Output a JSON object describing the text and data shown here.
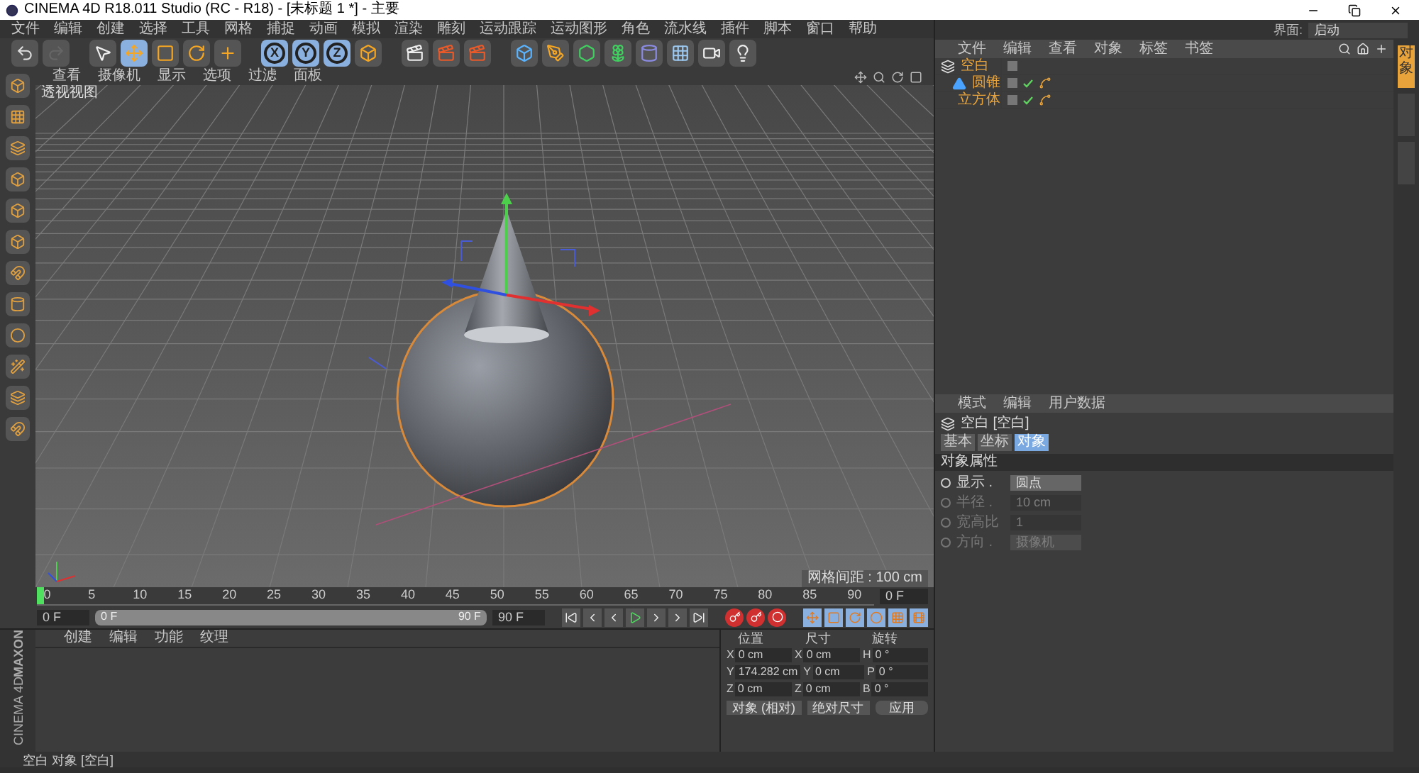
{
  "window": {
    "title": "CINEMA 4D R18.011 Studio (RC - R18) - [未标题 1 *] - 主要"
  },
  "menu_bar": [
    "文件",
    "编辑",
    "创建",
    "选择",
    "工具",
    "网格",
    "捕捉",
    "动画",
    "模拟",
    "渲染",
    "雕刻",
    "运动跟踪",
    "运动图形",
    "角色",
    "流水线",
    "插件",
    "脚本",
    "窗口",
    "帮助"
  ],
  "layout_selector": {
    "label": "界面:",
    "value": "启动"
  },
  "toolbar": {
    "tools": [
      {
        "kind": "select",
        "selected": false
      },
      {
        "kind": "move",
        "selected": true
      },
      {
        "kind": "scale",
        "selected": false
      },
      {
        "kind": "rotate",
        "selected": false
      },
      {
        "kind": "add",
        "selected": false
      }
    ],
    "axes": [
      {
        "label": "X",
        "selected": true
      },
      {
        "label": "Y",
        "selected": true
      },
      {
        "label": "Z",
        "selected": true
      }
    ]
  },
  "viewport": {
    "menus": [
      "查看",
      "摄像机",
      "显示",
      "选项",
      "过滤",
      "面板"
    ],
    "label": "透视视图",
    "grid_info": "网格间距 : 100 cm"
  },
  "object_manager": {
    "menus": [
      "文件",
      "编辑",
      "查看",
      "对象",
      "标签",
      "书签"
    ],
    "side_tabs": [
      {
        "label": "对象",
        "selected": true
      },
      {
        "selected": false
      },
      {
        "selected": false
      }
    ],
    "objects": [
      {
        "name": "空白",
        "kind": "null",
        "children": [
          {
            "name": "圆锥",
            "kind": "cone"
          },
          {
            "name": "立方体",
            "kind": "cube"
          }
        ]
      }
    ]
  },
  "attributes": {
    "menus": [
      "模式",
      "编辑",
      "用户数据"
    ],
    "title": "空白 [空白]",
    "tabs": [
      {
        "label": "基本",
        "selected": false
      },
      {
        "label": "坐标",
        "selected": false
      },
      {
        "label": "对象",
        "selected": true
      }
    ],
    "section": "对象属性",
    "fields": [
      {
        "label": "显示 .",
        "value": "圆点",
        "kind": "dropdown",
        "disabled": false
      },
      {
        "label": "半径 .",
        "value": "10 cm",
        "kind": "number",
        "disabled": true
      },
      {
        "label": "宽高比",
        "value": "1",
        "kind": "number",
        "disabled": true
      },
      {
        "label": "方向 .",
        "value": "摄像机",
        "kind": "dropdown",
        "disabled": true
      }
    ]
  },
  "timeline": {
    "ticks": [
      "0",
      "5",
      "10",
      "15",
      "20",
      "25",
      "30",
      "35",
      "40",
      "45",
      "50",
      "55",
      "60",
      "65",
      "70",
      "75",
      "80",
      "85",
      "90"
    ],
    "current_frame": "0 F",
    "playhead": {
      "level": 0
    },
    "start": "0 F",
    "range": {
      "level": 1
    },
    "range_start": "0 F",
    "range_end": "90 F",
    "end": "90 F"
  },
  "material_manager": {
    "menus": [
      "创建",
      "编辑",
      "功能",
      "纹理"
    ]
  },
  "brand": [
    "MAXON",
    "CINEMA 4D"
  ],
  "coordinates": {
    "headers": [
      "位置",
      "尺寸",
      "旋转"
    ],
    "columns": [
      [
        {
          "axis": "X",
          "value": "0 cm"
        },
        {
          "axis": "Y",
          "value": "174.282 cm"
        },
        {
          "axis": "Z",
          "value": "0 cm"
        }
      ],
      [
        {
          "axis": "X",
          "value": "0 cm"
        },
        {
          "axis": "Y",
          "value": "0 cm"
        },
        {
          "axis": "Z",
          "value": "0 cm"
        }
      ],
      [
        {
          "axis": "H",
          "value": "0 °"
        },
        {
          "axis": "P",
          "value": "0 °"
        },
        {
          "axis": "B",
          "value": "0 °"
        }
      ]
    ],
    "mode": "对象 (相对)",
    "size_mode": "绝对尺寸",
    "apply": "应用"
  },
  "status_bar": "空白 对象 [空白]"
}
